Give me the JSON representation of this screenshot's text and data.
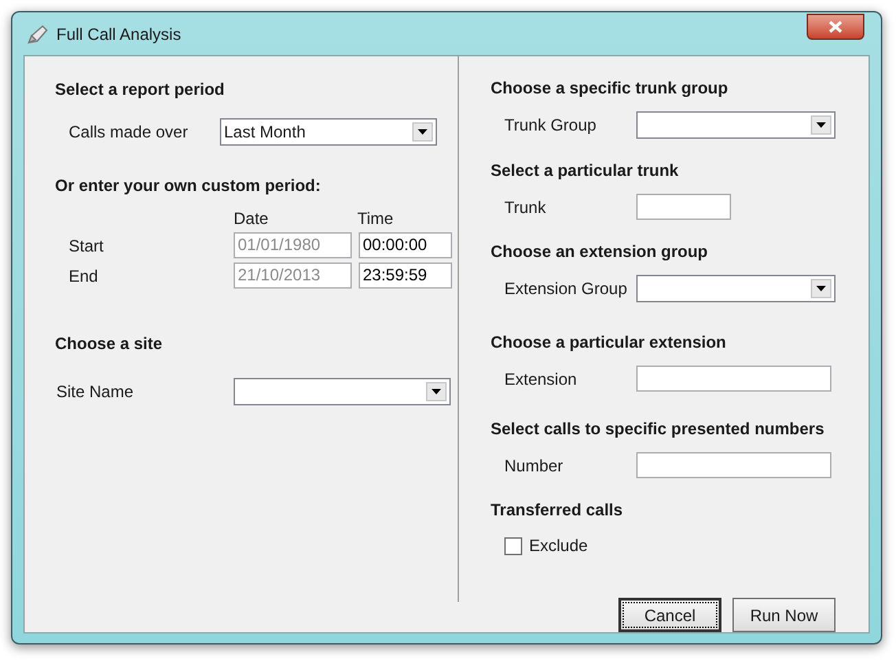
{
  "window": {
    "title": "Full Call Analysis"
  },
  "report_period": {
    "heading": "Select a report period",
    "label": "Calls made over",
    "value": "Last Month"
  },
  "custom_period": {
    "heading": "Or enter your own custom period:",
    "date_header": "Date",
    "time_header": "Time",
    "rows": [
      {
        "label": "Start",
        "date": "01/01/1980",
        "date_disabled": true,
        "time": "00:00:00"
      },
      {
        "label": "End",
        "date": "21/10/2013",
        "date_disabled": true,
        "time": "23:59:59"
      }
    ]
  },
  "site": {
    "heading": "Choose a site",
    "label": "Site Name"
  },
  "filters": [
    {
      "kind": "dropdown",
      "heading": "Choose a specific trunk group",
      "label": "Trunk Group"
    },
    {
      "kind": "short_field",
      "heading": "Select a particular trunk",
      "label": "Trunk"
    },
    {
      "kind": "dropdown",
      "heading": "Choose an extension group",
      "label": "Extension Group"
    },
    {
      "kind": "field",
      "heading": "Choose a particular extension",
      "label": "Extension"
    },
    {
      "kind": "field",
      "heading": "Select calls to specific presented numbers",
      "label": "Number"
    }
  ],
  "transferred": {
    "heading": "Transferred calls",
    "label": "Exclude",
    "checked": false
  },
  "buttons": [
    {
      "label": "Cancel",
      "focused": true
    },
    {
      "label": "Run Now",
      "focused": false
    }
  ]
}
